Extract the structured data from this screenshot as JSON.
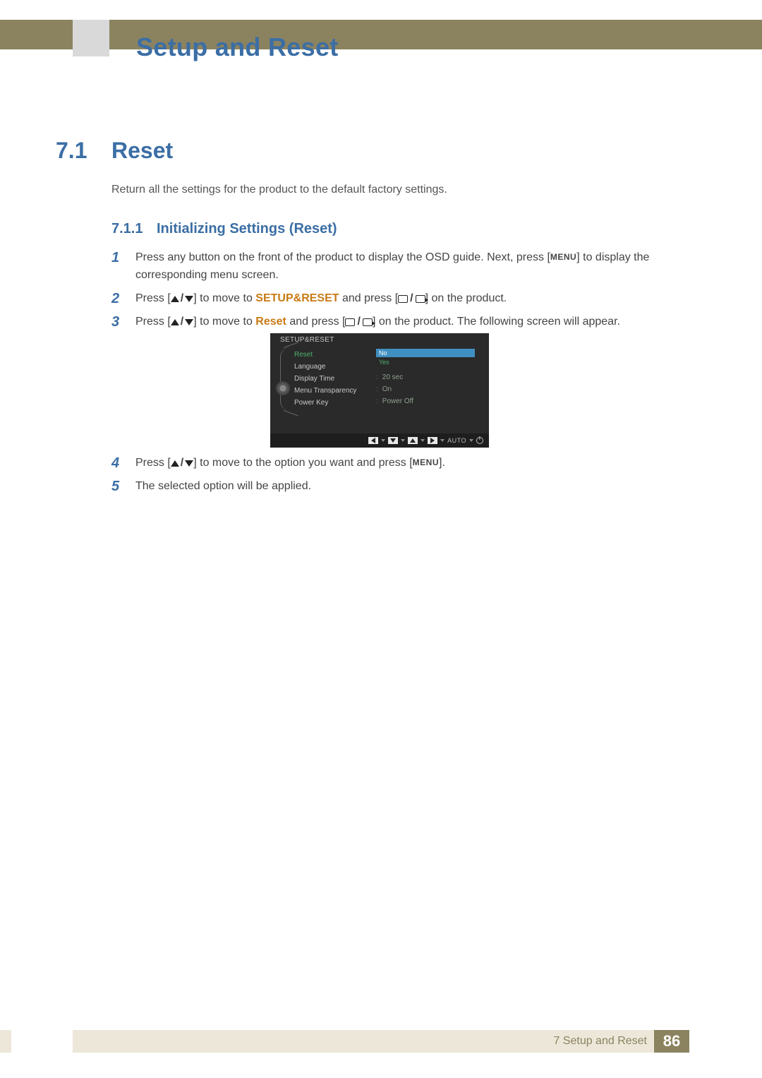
{
  "header": {
    "chapter_title": "Setup and Reset"
  },
  "section": {
    "num": "7.1",
    "title": "Reset",
    "intro": "Return all the settings for the product to the default factory settings."
  },
  "subsection": {
    "num": "7.1.1",
    "title": "Initializing Settings (Reset)"
  },
  "steps": {
    "s1": {
      "num": "1",
      "part1": "Press any button on the front of the product to display the OSD guide. Next, press [",
      "menu": "MENU",
      "part2": "] to display the corresponding menu screen."
    },
    "s2": {
      "num": "2",
      "part1": "Press [",
      "part2": "] to move to ",
      "kw": "SETUP&RESET",
      "part3": " and press [",
      "part4": "] on the product."
    },
    "s3": {
      "num": "3",
      "part1": "Press [",
      "part2": "] to move to ",
      "kw": "Reset",
      "part3": " and press [",
      "part4": "] on the product. The following screen will appear."
    },
    "s4": {
      "num": "4",
      "part1": "Press [",
      "part2": "] to move to the option you want and press [",
      "menu": "MENU",
      "part3": "]."
    },
    "s5": {
      "num": "5",
      "text": "The selected option will be applied."
    }
  },
  "osd": {
    "title": "SETUP&RESET",
    "items": {
      "reset": "Reset",
      "language": "Language",
      "display_time": "Display Time",
      "menu_transparency": "Menu Transparency",
      "power_key": "Power Key"
    },
    "options": {
      "no": "No",
      "yes": "Yes"
    },
    "values": {
      "display_time": "20 sec",
      "menu_transparency": "On",
      "power_key": "Power Off"
    },
    "nav_auto": "AUTO"
  },
  "footer": {
    "text": "7 Setup and Reset",
    "page": "86"
  }
}
